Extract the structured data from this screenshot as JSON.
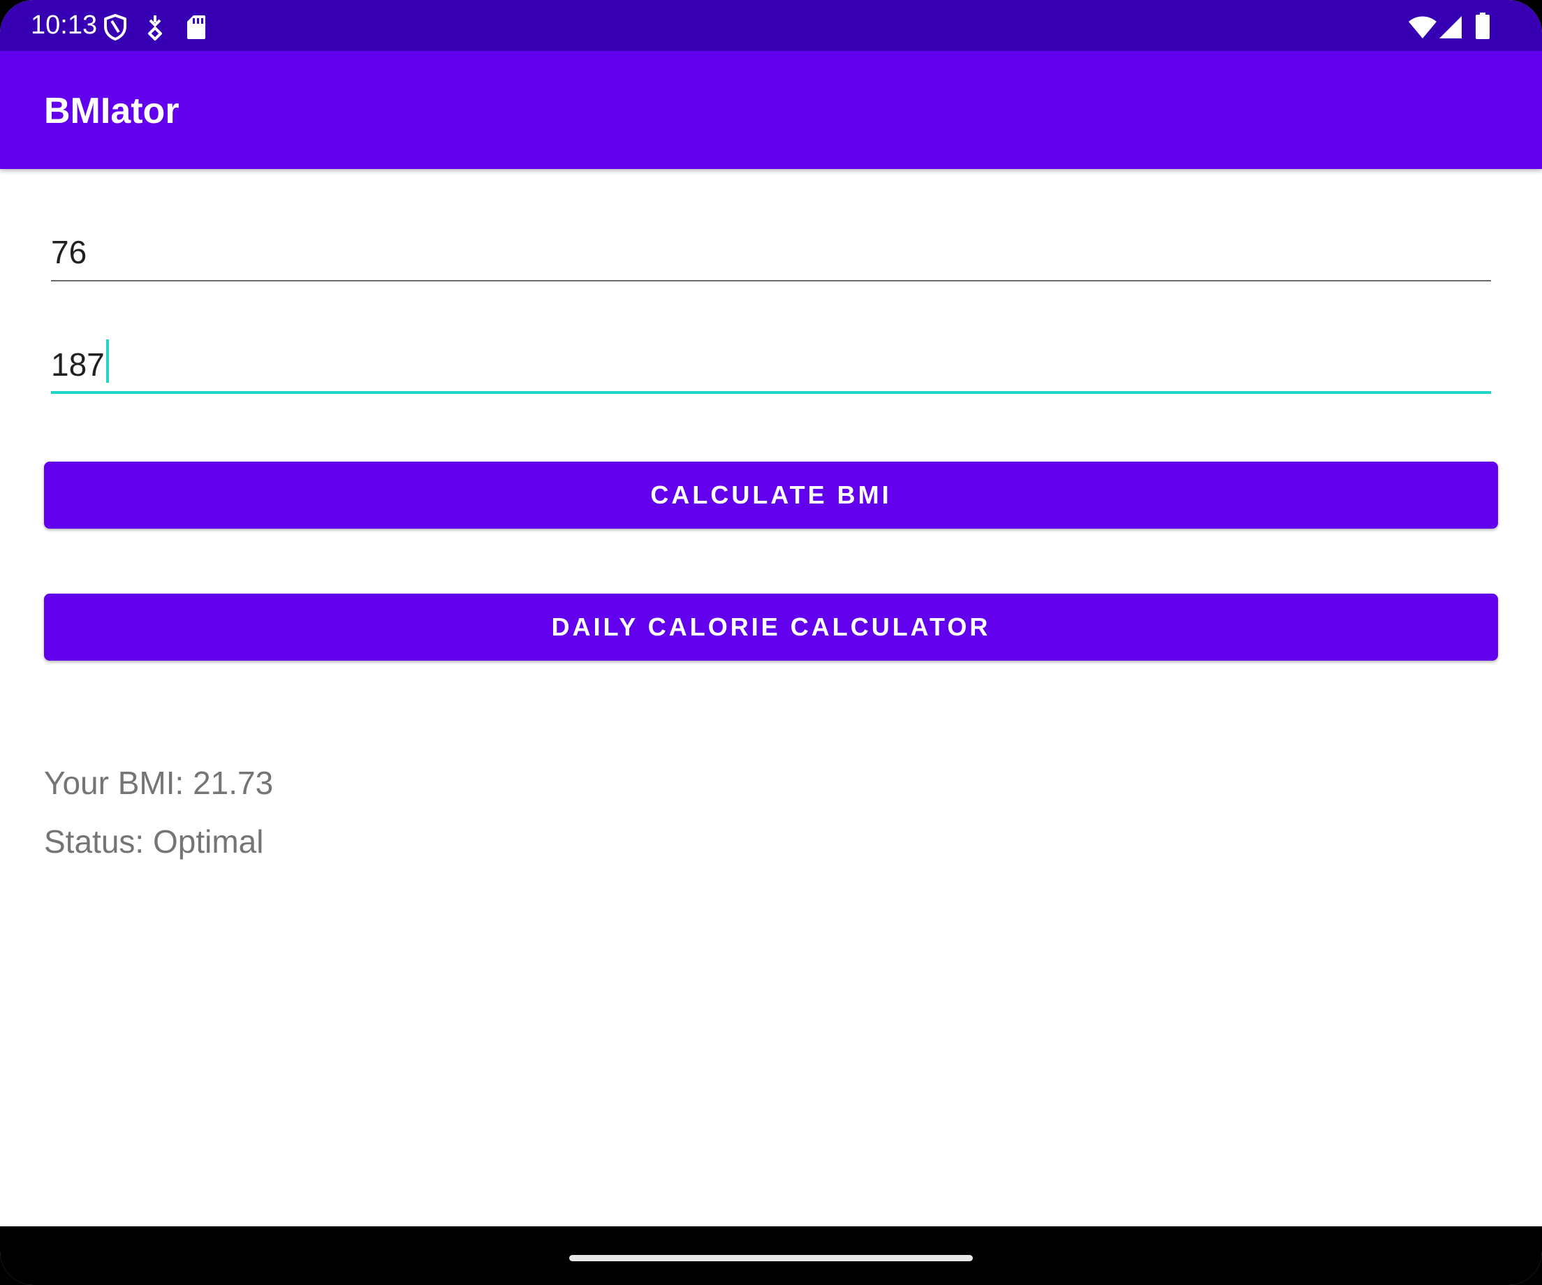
{
  "status_bar": {
    "time": "10:13",
    "left_icons": [
      "shield-icon",
      "download-icon",
      "sd-card-icon"
    ],
    "right_icons": [
      "wifi-icon",
      "cellular-signal-icon",
      "battery-icon"
    ]
  },
  "app_bar": {
    "title": "BMIator"
  },
  "inputs": {
    "weight_value": "76",
    "height_value": "187"
  },
  "buttons": {
    "calculate_label": "CALCULATE BMI",
    "calorie_label": "DAILY CALORIE CALCULATOR"
  },
  "results": {
    "bmi_text": "Your BMI: 21.73",
    "status_text": "Status: Optimal"
  },
  "colors": {
    "status_bar": "#3700B3",
    "primary": "#6200EE",
    "accent": "#1DD6C5",
    "result_text": "#757575"
  }
}
